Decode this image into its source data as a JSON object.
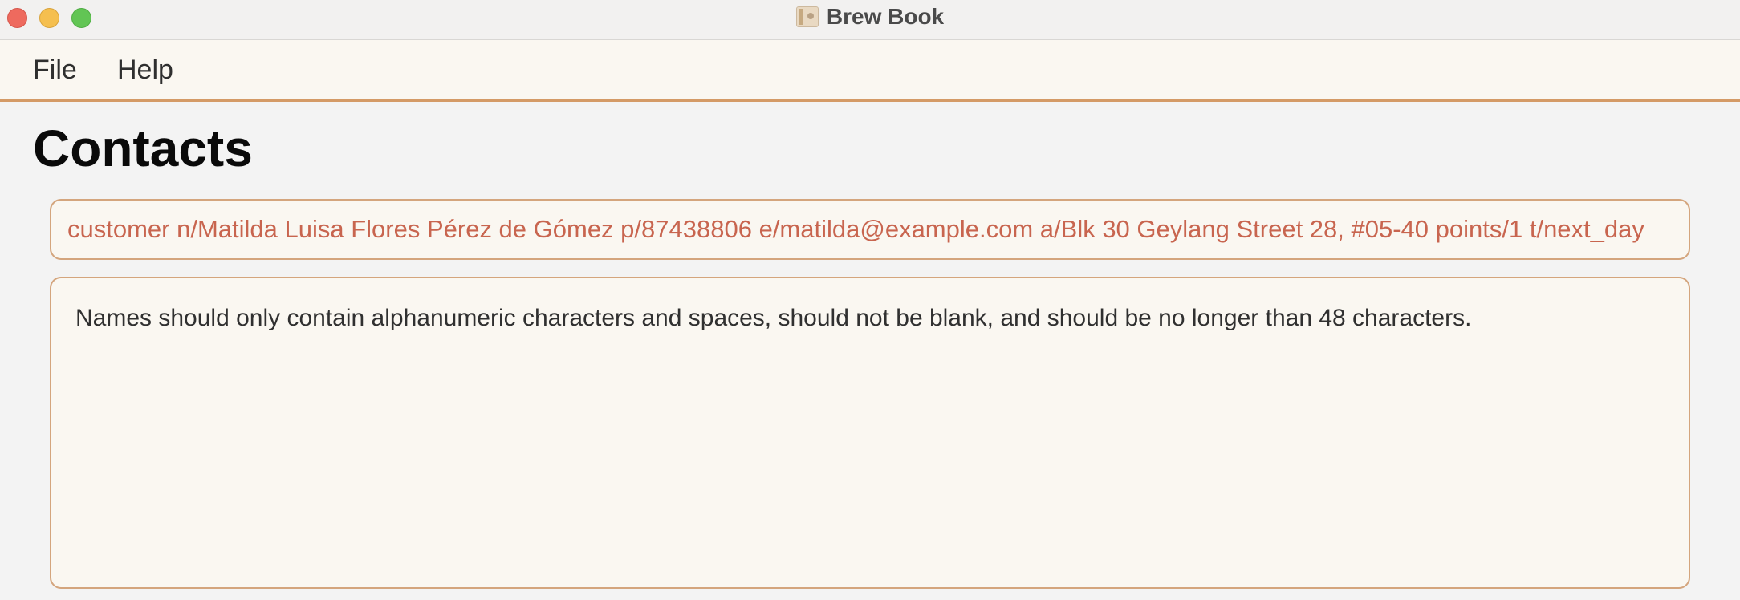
{
  "window": {
    "title": "Brew Book",
    "traffic_lights": [
      "close",
      "minimize",
      "maximize"
    ]
  },
  "menu": {
    "items": [
      {
        "label": "File"
      },
      {
        "label": "Help"
      }
    ]
  },
  "main": {
    "heading": "Contacts",
    "command": {
      "value": "customer n/Matilda Luisa Flores Pérez de Gómez p/87438806 e/matilda@example.com a/Blk 30 Geylang Street 28, #05-40 points/1 t/next_day",
      "text_color": "#c8654f"
    },
    "result": {
      "message": "Names should only contain alphanumeric characters and spaces, should not be blank, and should be no longer than 48 characters."
    }
  },
  "colors": {
    "accent": "#d49a66",
    "panel_bg": "#faf7f1",
    "page_bg": "#f3f3f3"
  }
}
